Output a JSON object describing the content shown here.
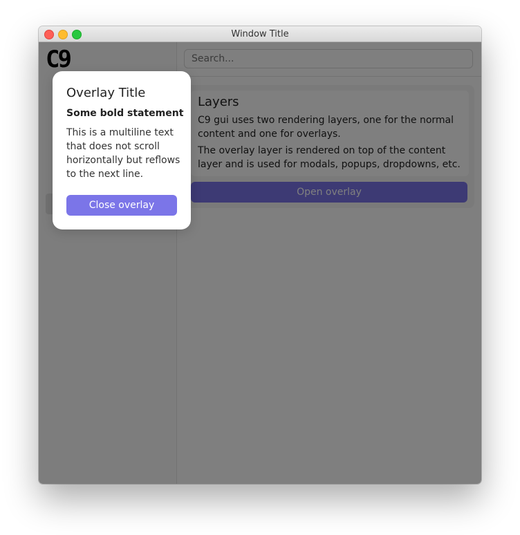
{
  "window": {
    "title": "Window Title"
  },
  "logo": {
    "text": "C9"
  },
  "search": {
    "placeholder": "Search..."
  },
  "layers_card": {
    "title": "Layers",
    "paragraph_1": "C9 gui uses two rendering layers, one for the normal content and one for overlays.",
    "paragraph_2": "The overlay layer is rendered on top of the content layer and is used for modals, popups, dropdowns, etc.",
    "open_button_label": "Open overlay"
  },
  "overlay": {
    "title": "Overlay Title",
    "bold_statement": "Some bold statement",
    "body_text": "This is a multiline text that does not scroll horizontally but reflows to the next line.",
    "close_button_label": "Close overlay"
  },
  "colors": {
    "accent": "#7b75e8",
    "dim": "rgba(0,0,0,0.5)"
  }
}
